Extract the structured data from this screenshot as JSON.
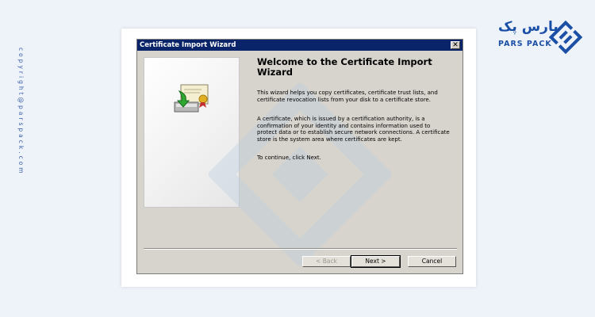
{
  "page": {
    "copyright": "copyright@parspack.com",
    "logo_fa": "پارس پک",
    "logo_en": "PARS PACK"
  },
  "window": {
    "title": "Certificate Import Wizard",
    "close_label": "✕"
  },
  "content": {
    "heading": "Welcome to the Certificate Import Wizard",
    "paragraph_1": "This wizard helps you copy certificates, certificate trust lists, and certificate revocation lists from your disk to a certificate store.",
    "paragraph_2": "A certificate, which is issued by a certification authority, is a confirmation of your identity and contains information used to protect data or to establish secure network connections. A certificate store is the system area where certificates are kept.",
    "paragraph_3": "To continue, click Next."
  },
  "buttons": {
    "back": "< Back",
    "next": "Next >",
    "cancel": "Cancel"
  },
  "colors": {
    "title_bar": "#0a246a",
    "dialog_bg": "#d7d4cd",
    "brand_blue": "#1b4fa6"
  },
  "icons": [
    "wizard-certificate-icon",
    "close-icon",
    "parspack-logo-icon"
  ]
}
